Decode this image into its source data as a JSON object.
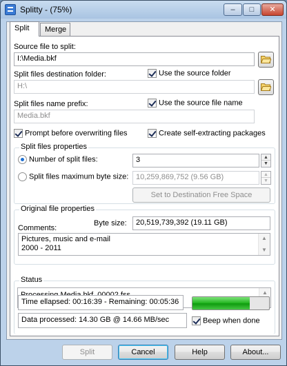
{
  "window": {
    "title": "Splitty - (75%)",
    "controls": {
      "minimize": "–",
      "maximize": "□",
      "close": "✕"
    }
  },
  "tabs": [
    {
      "label": "Split",
      "active": true
    },
    {
      "label": "Merge",
      "active": false
    }
  ],
  "source": {
    "label": "Source file to split:",
    "value": "I:\\Media.bkf",
    "browse_icon": "folder-open-icon"
  },
  "destination": {
    "label": "Split files destination folder:",
    "use_source_label": "Use the source folder",
    "use_source_checked": true,
    "value": "H:\\",
    "browse_icon": "folder-open-icon"
  },
  "prefix": {
    "label": "Split files name prefix:",
    "use_source_label": "Use the source file name",
    "use_source_checked": true,
    "value": "Media.bkf"
  },
  "options": {
    "prompt_overwrite_label": "Prompt before overwriting files",
    "prompt_overwrite_checked": true,
    "self_extracting_label": "Create self-extracting packages",
    "self_extracting_checked": true
  },
  "split_properties": {
    "title": "Split files properties",
    "number_label": "Number of split files:",
    "number_selected": true,
    "number_value": "3",
    "max_size_label": "Split files maximum byte size:",
    "max_size_selected": false,
    "max_size_value": "10,259,869,752 (9.56 GB)",
    "set_free_space_button": "Set to Destination Free Space"
  },
  "original_properties": {
    "title": "Original file properties",
    "byte_size_label": "Byte size:",
    "byte_size_value": "20,519,739,392 (19.11 GB)",
    "comments_label": "Comments:",
    "comments_lines": [
      "Pictures, music and e-mail",
      "2000 - 2011"
    ]
  },
  "status": {
    "title": "Status",
    "message": "Processing Media.bkf_00002.fss...",
    "time_text": "Time ellapsed: 00:16:39 - Remaining: 00:05:36",
    "data_text": "Data processed: 14.30 GB @ 14.66 MB/sec",
    "progress_fraction": 0.75,
    "beep_label": "Beep when done",
    "beep_checked": true
  },
  "buttons": {
    "split": "Split",
    "cancel": "Cancel",
    "help": "Help",
    "about": "About..."
  },
  "colors": {
    "titlebar": "#bcd2ea",
    "progress": "#1fb41d"
  }
}
